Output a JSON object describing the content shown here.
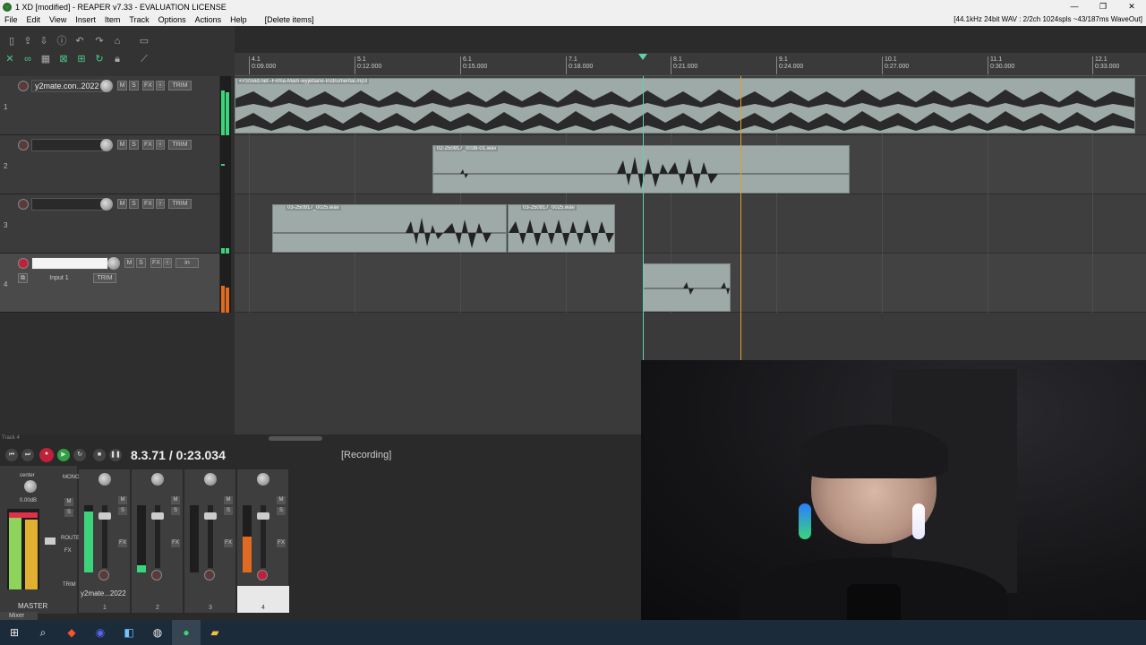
{
  "window": {
    "title": "1 XD [modified] - REAPER v7.33 - EVALUATION LICENSE",
    "min": "—",
    "max": "❐",
    "close": "✕"
  },
  "menu": {
    "items": [
      "File",
      "Edit",
      "View",
      "Insert",
      "Item",
      "Track",
      "Options",
      "Actions",
      "Help",
      "[Delete items]"
    ],
    "status": "[44.1kHz 24bit WAV : 2/2ch 1024spls ~43/187ms WaveOut]"
  },
  "timeline": {
    "ticks": [
      {
        "bar": "4.1",
        "time": "0:09.000"
      },
      {
        "bar": "5.1",
        "time": "0:12.000"
      },
      {
        "bar": "6.1",
        "time": "0:15.000"
      },
      {
        "bar": "7.1",
        "time": "0:18.000"
      },
      {
        "bar": "8.1",
        "time": "0:21.000"
      },
      {
        "bar": "9.1",
        "time": "0:24.000"
      },
      {
        "bar": "10.1",
        "time": "0:27.000"
      },
      {
        "bar": "11.1",
        "time": "0:30.000"
      },
      {
        "bar": "12.1",
        "time": "0:33.000"
      }
    ]
  },
  "tracks": [
    {
      "num": "1",
      "name": "y2mate.con..2022",
      "armed": false
    },
    {
      "num": "2",
      "name": "",
      "armed": false
    },
    {
      "num": "3",
      "name": "",
      "armed": false
    },
    {
      "num": "4",
      "name": "",
      "armed": true,
      "input": "Input 1"
    }
  ],
  "track_buttons": {
    "mute": "M",
    "solo": "S",
    "fx": "FX",
    "trim": "TRIM",
    "io": "in"
  },
  "items": {
    "item1": "<<SSvid.net--Firma-Mam-wyjebane-Instrumental.mp3",
    "item2": "02-250917_0038-01.wav",
    "item3": "03-250917_0025.wav",
    "item4": "03-250917_0025.wav"
  },
  "transport": {
    "time": "8.3.71 / 0:23.034",
    "status": "[Recording]",
    "track_label": "Track 4"
  },
  "mixer": {
    "master_label": "MASTER",
    "center": "center",
    "master_db": "0.00dB",
    "strip1_name": "y2mate...2022",
    "strips": [
      "1",
      "2",
      "3",
      "4"
    ],
    "tab": "Mixer",
    "buttons": {
      "mono": "MONO",
      "route": "ROUTE",
      "fx": "FX",
      "trim": "TRIM",
      "m": "M",
      "s": "S"
    }
  },
  "colors": {
    "accent": "#4ec98a",
    "record": "#c0203a",
    "playhead": "#e0a030",
    "item": "#9eaaa8"
  }
}
